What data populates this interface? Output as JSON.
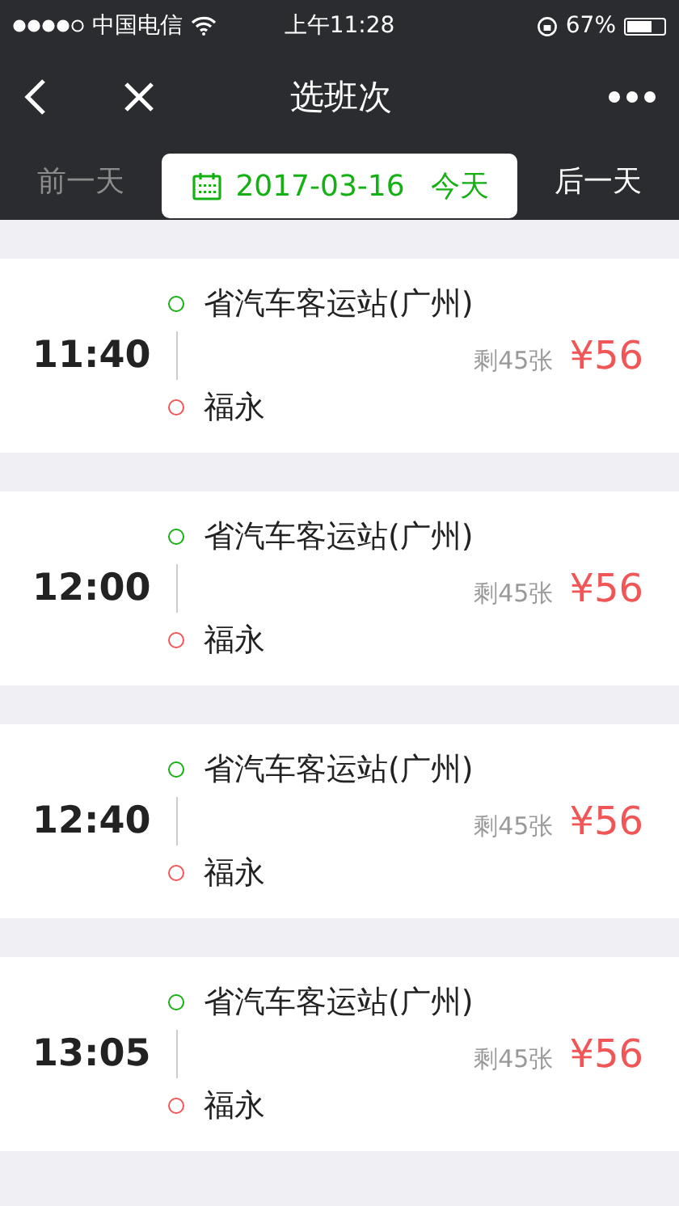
{
  "status_bar": {
    "carrier": "中国电信",
    "time": "上午11:28",
    "battery": "67%"
  },
  "nav_bar": {
    "title": "选班次"
  },
  "date_bar": {
    "prev": {
      "label": "前一天",
      "disabled": true
    },
    "current": {
      "date": "2017-03-16",
      "day": "今天"
    },
    "next": {
      "label": "后一天",
      "disabled": false
    }
  },
  "trips": [
    {
      "time": "11:40",
      "from": "省汽车客运站(广州)",
      "to": "福永",
      "remaining": "剩45张",
      "price": "¥56"
    },
    {
      "time": "12:00",
      "from": "省汽车客运站(广州)",
      "to": "福永",
      "remaining": "剩45张",
      "price": "¥56"
    },
    {
      "time": "12:40",
      "from": "省汽车客运站(广州)",
      "to": "福永",
      "remaining": "剩45张",
      "price": "¥56"
    },
    {
      "time": "13:05",
      "from": "省汽车客运站(广州)",
      "to": "福永",
      "remaining": "剩45张",
      "price": "¥56"
    }
  ]
}
